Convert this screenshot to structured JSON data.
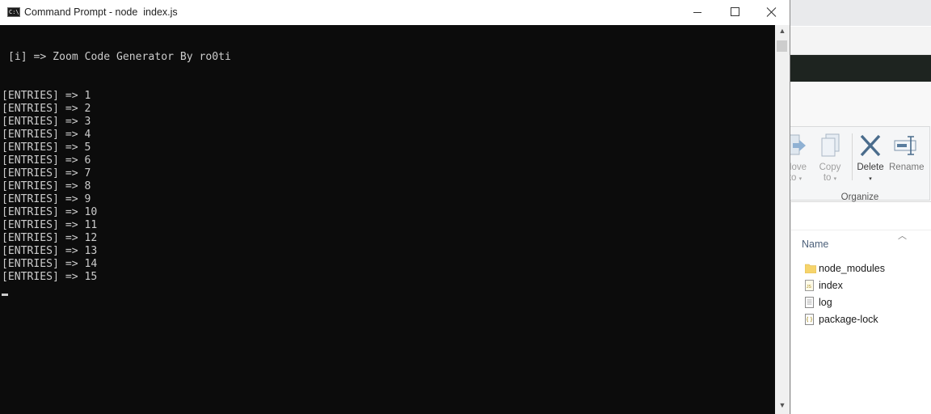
{
  "cmd": {
    "title": "Command Prompt - node  index.js",
    "icon_text": "C:\\",
    "banner": "[i] => Zoom Code Generator By ro0ti",
    "entries": [
      "[ENTRIES] => 1",
      "[ENTRIES] => 2",
      "[ENTRIES] => 3",
      "[ENTRIES] => 4",
      "[ENTRIES] => 5",
      "[ENTRIES] => 6",
      "[ENTRIES] => 7",
      "[ENTRIES] => 8",
      "[ENTRIES] => 9",
      "[ENTRIES] => 10",
      "[ENTRIES] => 11",
      "[ENTRIES] => 12",
      "[ENTRIES] => 13",
      "[ENTRIES] => 14",
      "[ENTRIES] => 15"
    ],
    "colors": {
      "background": "#0c0c0c",
      "text": "#cccccc"
    }
  },
  "explorer": {
    "ribbon": {
      "move_to": {
        "line1": "Move",
        "line2": "to"
      },
      "copy_to": {
        "line1": "Copy",
        "line2": "to"
      },
      "delete": "Delete",
      "rename": "Rename",
      "group": "Organize"
    },
    "column_header": "Name",
    "files": [
      {
        "name": "node_modules",
        "icon": "folder-icon"
      },
      {
        "name": "index",
        "icon": "js-file-icon"
      },
      {
        "name": "log",
        "icon": "text-file-icon"
      },
      {
        "name": "package-lock",
        "icon": "json-file-icon"
      }
    ]
  }
}
